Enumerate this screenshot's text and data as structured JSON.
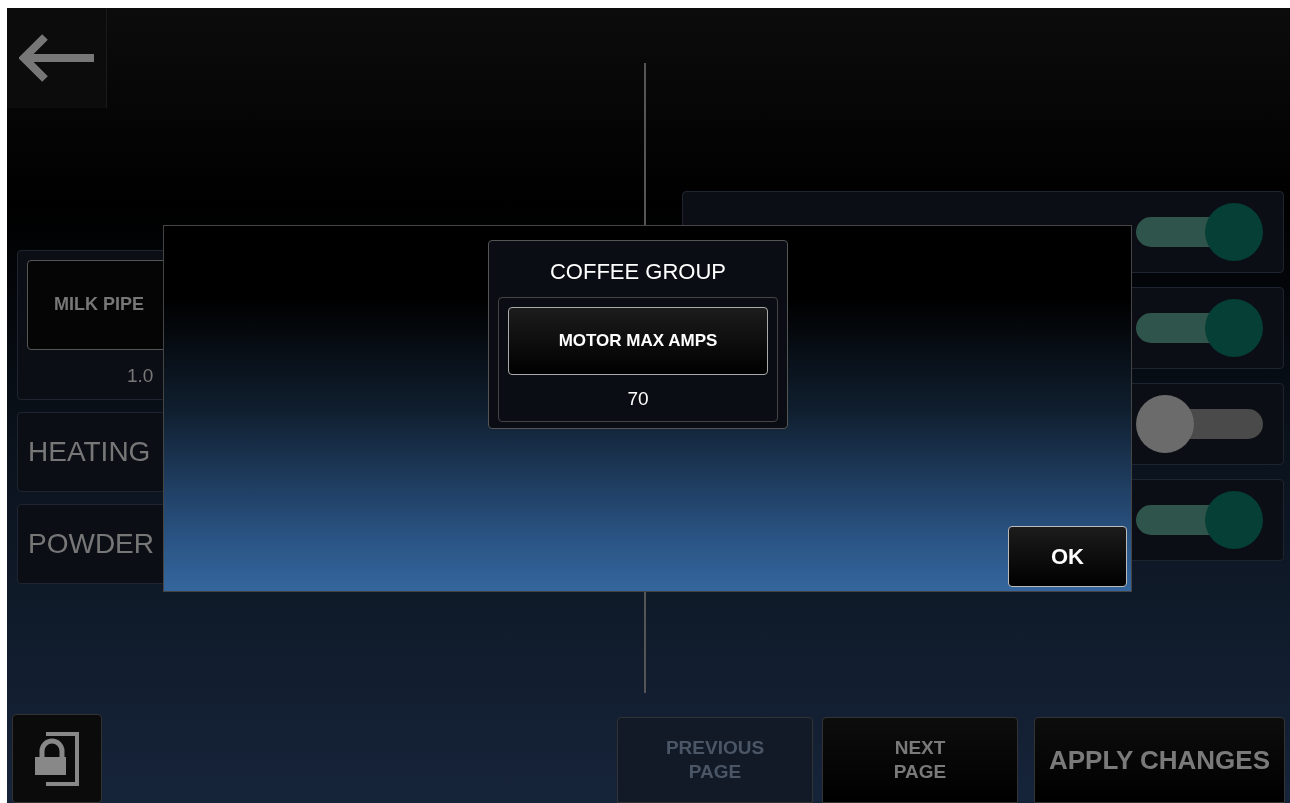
{
  "left_settings": [
    {
      "kind": "button",
      "label": "MILK PIPE",
      "value": "1.0"
    },
    {
      "kind": "label",
      "label": "HEATING"
    },
    {
      "kind": "label",
      "label": "POWDER"
    }
  ],
  "right_settings": [
    {
      "on": true
    },
    {
      "on": true
    },
    {
      "on": false
    },
    {
      "on": true
    }
  ],
  "dialog": {
    "group_title": "COFFEE GROUP",
    "parameter_button": "MOTOR MAX AMPS",
    "value": "70",
    "ok_button": "OK"
  },
  "bottom_buttons": [
    {
      "label": "PREVIOUS\nPAGE",
      "disabled": true,
      "kind": "small"
    },
    {
      "label": "NEXT\nPAGE",
      "disabled": false,
      "kind": "small"
    },
    {
      "label": "APPLY CHANGES",
      "disabled": false,
      "kind": "large"
    }
  ]
}
